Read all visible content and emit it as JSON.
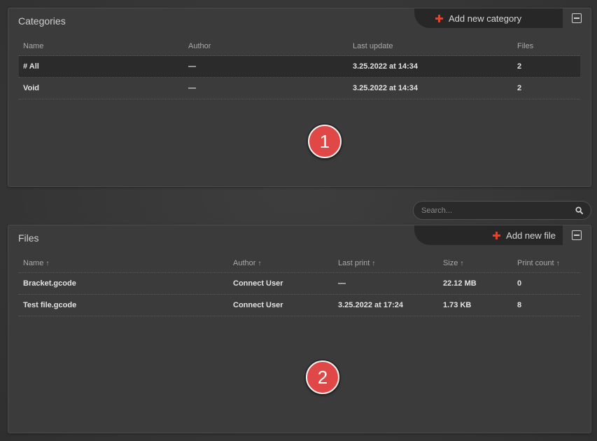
{
  "categories_panel": {
    "title": "Categories",
    "add_label": "Add new category",
    "columns": [
      "Name",
      "Author",
      "Last update",
      "Files"
    ],
    "rows": [
      {
        "name": "# All",
        "author": "—",
        "last_update": "3.25.2022 at 14:34",
        "files": "2",
        "selected": true
      },
      {
        "name": "Void",
        "author": "—",
        "last_update": "3.25.2022 at 14:34",
        "files": "2",
        "selected": false
      }
    ]
  },
  "search": {
    "placeholder": "Search..."
  },
  "files_panel": {
    "title": "Files",
    "add_label": "Add new file",
    "columns": [
      "Name",
      "Author",
      "Last print",
      "Size",
      "Print count"
    ],
    "sort_arrow": "↑",
    "rows": [
      {
        "name": "Bracket.gcode",
        "author": "Connect User",
        "last_print": "—",
        "size": "22.12 MB",
        "print_count": "0"
      },
      {
        "name": "Test file.gcode",
        "author": "Connect User",
        "last_print": "3.25.2022 at 17:24",
        "size": "1.73 KB",
        "print_count": "8"
      }
    ]
  },
  "markers": [
    "1",
    "2"
  ],
  "icons": {
    "add": "plus-icon",
    "collapse": "minus-box-icon",
    "search": "search-icon"
  },
  "colors": {
    "accent": "#e8402b",
    "marker": "#e04848"
  }
}
